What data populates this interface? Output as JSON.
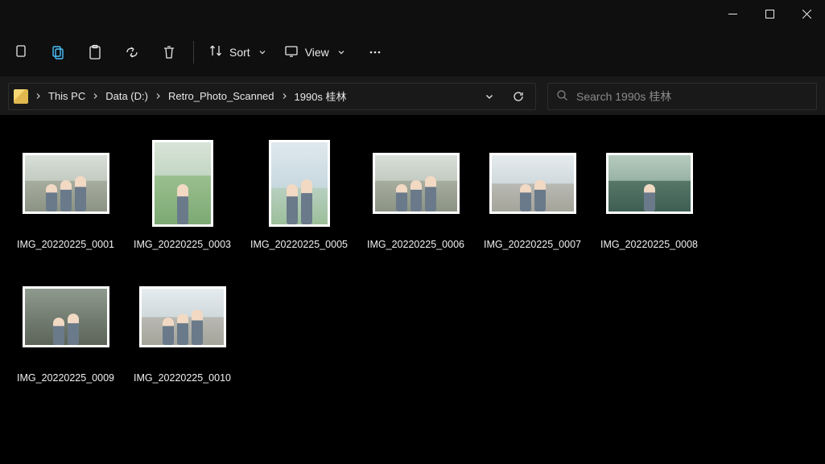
{
  "toolbar": {
    "sort_label": "Sort",
    "view_label": "View"
  },
  "breadcrumbs": [
    "This PC",
    "Data (D:)",
    "Retro_Photo_Scanned",
    "1990s 桂林"
  ],
  "search": {
    "placeholder": "Search 1990s 桂林"
  },
  "items": [
    {
      "name": "IMG_20220225_0001",
      "orient": "landscape",
      "scene": "rock",
      "people": 3
    },
    {
      "name": "IMG_20220225_0003",
      "orient": "portrait",
      "scene": "grass",
      "people": 1
    },
    {
      "name": "IMG_20220225_0005",
      "orient": "portrait",
      "scene": "sky",
      "people": 2
    },
    {
      "name": "IMG_20220225_0006",
      "orient": "landscape",
      "scene": "rock",
      "people": 3
    },
    {
      "name": "IMG_20220225_0007",
      "orient": "landscape",
      "scene": "street",
      "people": 2
    },
    {
      "name": "IMG_20220225_0008",
      "orient": "landscape",
      "scene": "water",
      "people": 1
    },
    {
      "name": "IMG_20220225_0009",
      "orient": "landscape",
      "scene": "indoor",
      "people": 2
    },
    {
      "name": "IMG_20220225_0010",
      "orient": "landscape",
      "scene": "street",
      "people": 3
    }
  ]
}
